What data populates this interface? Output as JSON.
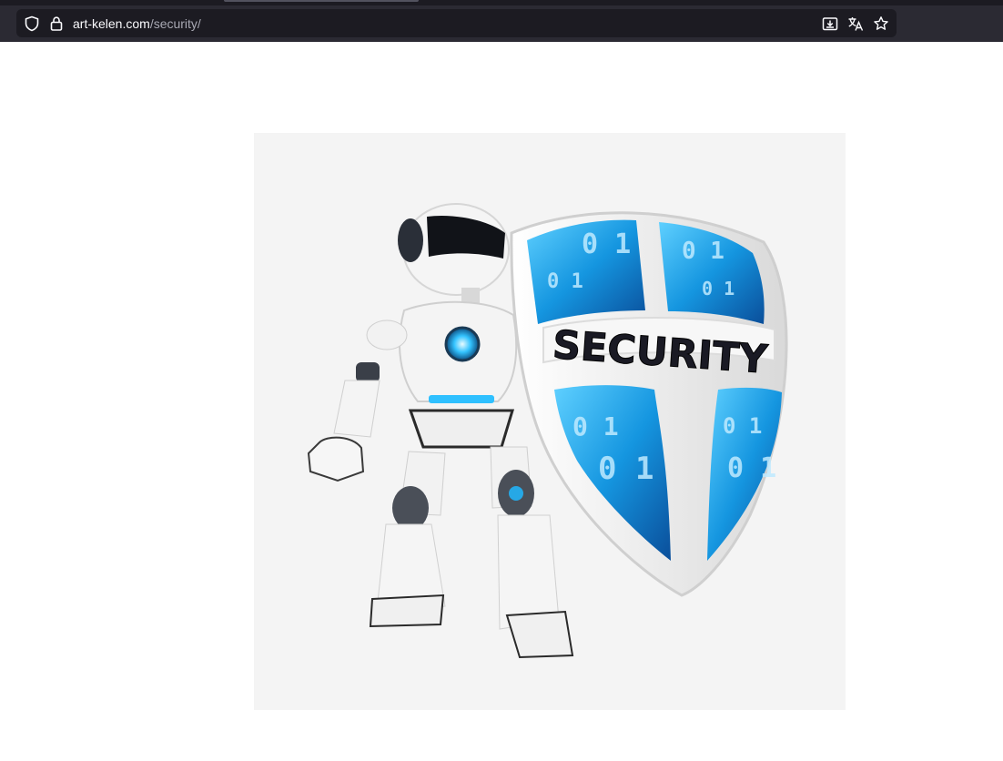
{
  "browser": {
    "url_domain": "art-kelen.com",
    "url_path": "/security/",
    "icons": [
      "shield-icon",
      "lock-icon",
      "download-icon",
      "translate-icon",
      "star-icon"
    ]
  },
  "page": {
    "image": {
      "alt": "Robot with security shield",
      "shield_text": "SECURITY",
      "binary_digits": "0 1"
    }
  },
  "colors": {
    "chrome": "#2b2a33",
    "urlbar": "#1c1b22",
    "accent_blue": "#1aa3e8",
    "robot_white": "#f2f2f2"
  }
}
